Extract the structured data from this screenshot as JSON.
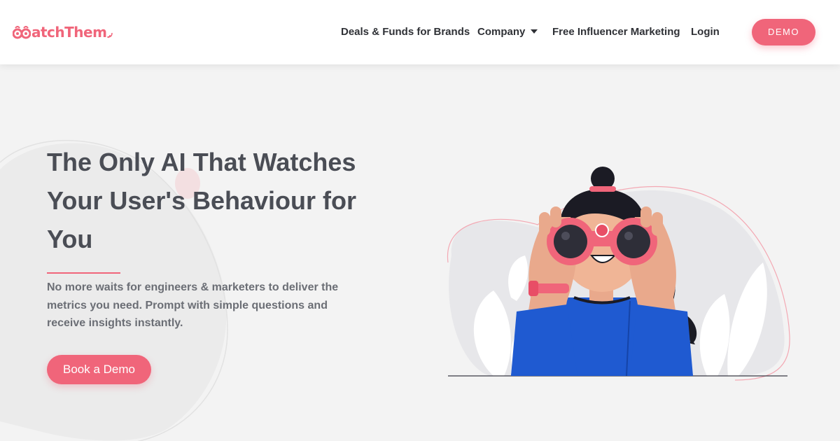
{
  "header": {
    "logo_text": "atchThem",
    "nav": [
      {
        "label": "Deals & Funds for Brands"
      },
      {
        "label": "Company"
      },
      {
        "label": "Free Influencer Marketing"
      },
      {
        "label": "Login"
      }
    ],
    "demo_label": "DEMO"
  },
  "hero": {
    "title_lines": [
      "The Only AI That Watches",
      "Your User's Behaviour for",
      "You"
    ],
    "subtitle": "No more waits for engineers & marketers to deliver the metrics you need. Prompt with simple questions and receive insights instantly.",
    "cta_label": "Book a Demo"
  },
  "colors": {
    "accent": "#f0657a",
    "text_dark": "#4a4d55",
    "text_muted": "#6b6e75",
    "background": "#f3f3f3",
    "shirt": "#1f5ad1"
  },
  "icons": {
    "logo": "binoculars-eyes-logo",
    "company_dropdown": "caret-down-icon"
  }
}
